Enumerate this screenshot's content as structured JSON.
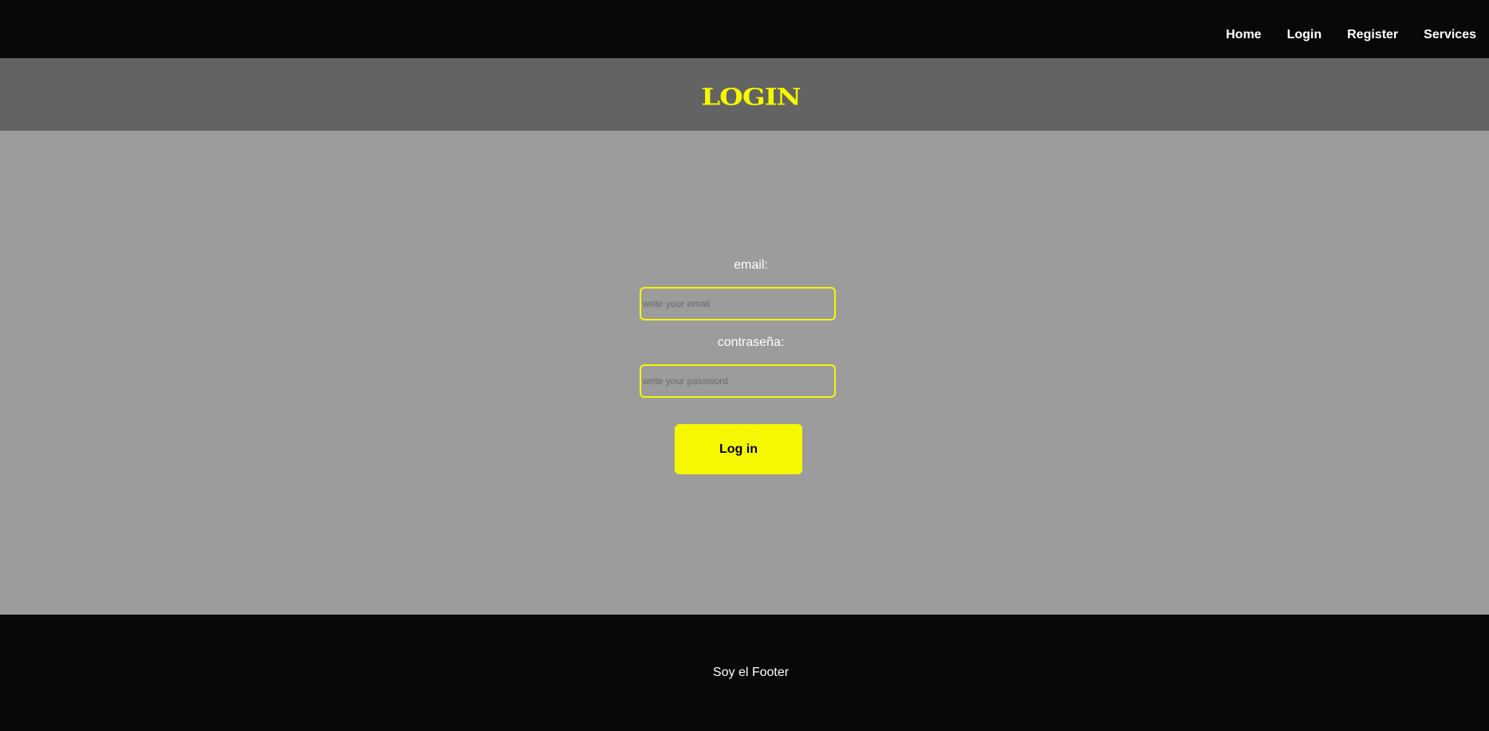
{
  "nav": {
    "items": [
      {
        "label": "Home"
      },
      {
        "label": "Login"
      },
      {
        "label": "Register"
      },
      {
        "label": "Services"
      }
    ]
  },
  "header": {
    "title": "LOGIN"
  },
  "form": {
    "email_label": "email:",
    "email_placeholder": "write your email",
    "email_value": "",
    "password_label": "contraseña:",
    "password_placeholder": "write your password",
    "password_value": "",
    "submit_label": "Log in"
  },
  "footer": {
    "text": "Soy el Footer"
  },
  "colors": {
    "accent": "#f6f800",
    "navbar_bg": "#080808",
    "header_bg": "#636363",
    "main_bg": "#9c9c9c",
    "footer_bg": "#080808"
  }
}
